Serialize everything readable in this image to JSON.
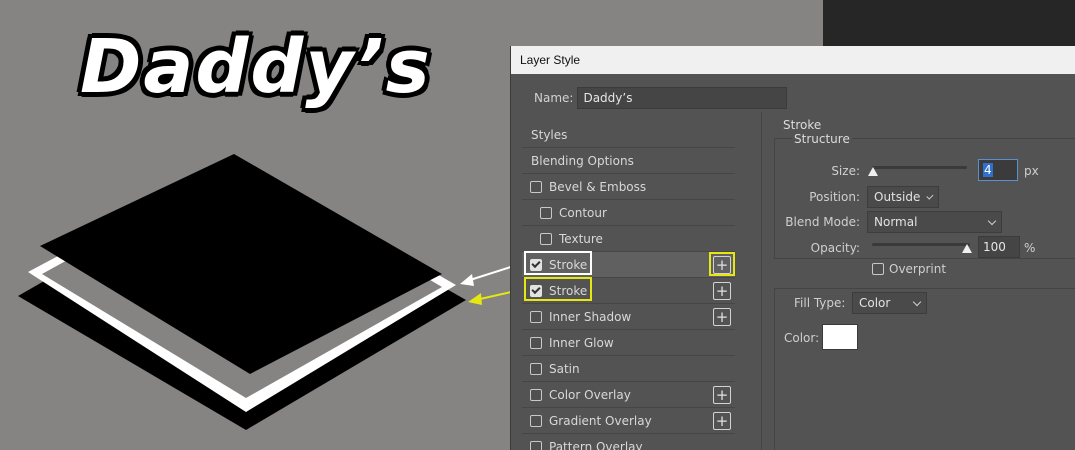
{
  "canvas": {
    "art_title": "Daddy’s"
  },
  "dialog": {
    "title": "Layer Style",
    "name_label": "Name:",
    "name_value": "Daddy’s"
  },
  "styles_panel": {
    "items": [
      {
        "label": "Styles"
      },
      {
        "label": "Blending Options"
      },
      {
        "label": "Bevel & Emboss",
        "checked": false
      },
      {
        "label": "Contour",
        "checked": false
      },
      {
        "label": "Texture",
        "checked": false
      },
      {
        "label": "Stroke",
        "checked": true
      },
      {
        "label": "Stroke",
        "checked": true
      },
      {
        "label": "Inner Shadow",
        "checked": false
      },
      {
        "label": "Inner Glow",
        "checked": false
      },
      {
        "label": "Satin",
        "checked": false
      },
      {
        "label": "Color Overlay",
        "checked": false
      },
      {
        "label": "Gradient Overlay",
        "checked": false
      },
      {
        "label": "Pattern Overlay",
        "checked": false
      }
    ],
    "add_icon": "plus-icon"
  },
  "stroke_settings": {
    "section_title": "Stroke",
    "group_title": "Structure",
    "size_label": "Size:",
    "size_value": "4",
    "size_unit": "px",
    "position_label": "Position:",
    "position_value": "Outside",
    "blend_label": "Blend Mode:",
    "blend_value": "Normal",
    "opacity_label": "Opacity:",
    "opacity_value": "100",
    "opacity_unit": "%",
    "overprint_label": "Overprint",
    "fill_type_label": "Fill Type:",
    "fill_type_value": "Color",
    "color_label": "Color:",
    "color_value": "#ffffff"
  },
  "annotations": {
    "white_highlight": "#ffffff",
    "yellow_highlight": "#e6e613"
  }
}
